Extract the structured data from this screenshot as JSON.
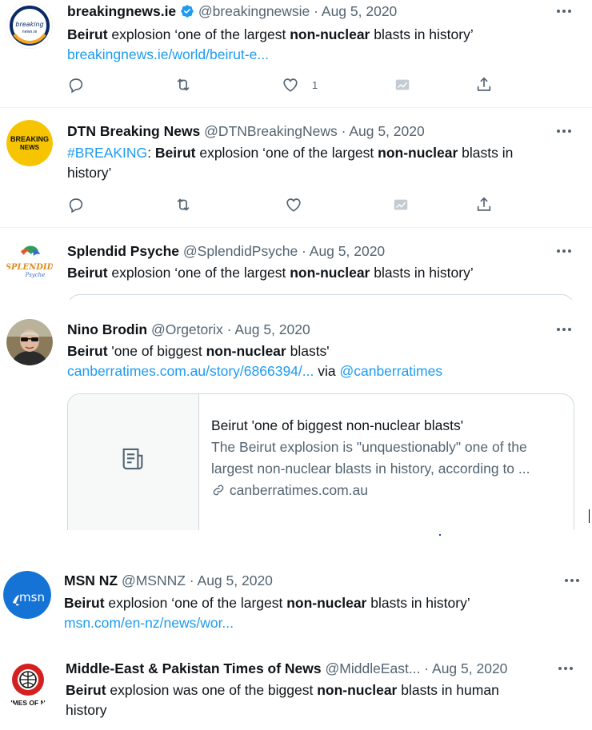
{
  "tweets": [
    {
      "name": "breakingnews.ie",
      "verified": true,
      "handle": "@breakingnewsie",
      "date": "Aug 5, 2020",
      "avatar": {
        "type": "logo",
        "label": "breaking news.ie"
      },
      "text_parts": [
        {
          "t": "Beirut",
          "b": true
        },
        {
          "t": " explosion ‘one of the largest "
        },
        {
          "t": "non-nuclear",
          "b": true
        },
        {
          "t": " blasts in history’"
        }
      ],
      "link": "breakingnews.ie/world/beirut-e...",
      "like_count": "1"
    },
    {
      "name": "DTN Breaking News",
      "handle": "@DTNBreakingNews",
      "date": "Aug 5, 2020",
      "avatar": {
        "type": "logo",
        "label_line1": "BREAKING",
        "label_line2": "NEWS"
      },
      "hashtag": "#BREAKING",
      "text_parts": [
        {
          "t": ": "
        },
        {
          "t": "Beirut",
          "b": true
        },
        {
          "t": " explosion ‘one of the largest "
        },
        {
          "t": "non-nuclear",
          "b": true
        },
        {
          "t": " blasts in history’"
        }
      ]
    },
    {
      "name": "Splendid Psyche",
      "handle": "@SplendidPsyche",
      "date": "Aug 5, 2020",
      "avatar": {
        "type": "logo",
        "label": "SPLENDID",
        "sub": "Psyche"
      },
      "text_parts": [
        {
          "t": "Beirut",
          "b": true
        },
        {
          "t": " explosion ‘one of the largest "
        },
        {
          "t": "non-nuclear",
          "b": true
        },
        {
          "t": " blasts in history’"
        }
      ]
    },
    {
      "name": "Nino Brodin",
      "handle": "@Orgetorix",
      "date": "Aug 5, 2020",
      "avatar": {
        "type": "photo"
      },
      "text_parts": [
        {
          "t": "Beirut",
          "b": true
        },
        {
          "t": " 'one of biggest "
        },
        {
          "t": "non-nuclear",
          "b": true
        },
        {
          "t": " blasts'"
        }
      ],
      "link": "canberratimes.com.au/story/6866394/...",
      "via_label": " via ",
      "via_handle": "@canberratimes",
      "card": {
        "title": "Beirut 'one of biggest non-nuclear blasts'",
        "description": "The Beirut explosion is \"unquestionably\" one of the largest non-nuclear blasts in history, according to ...",
        "domain": "canberratimes.com.au"
      }
    },
    {
      "name": "MSN NZ",
      "handle": "@MSNNZ",
      "date": "Aug 5, 2020",
      "avatar": {
        "type": "logo",
        "label": "msn"
      },
      "text_parts": [
        {
          "t": "Beirut",
          "b": true
        },
        {
          "t": " explosion ‘one of the largest "
        },
        {
          "t": "non-nuclear",
          "b": true
        },
        {
          "t": " blasts in history’"
        }
      ],
      "link": "msn.com/en-nz/news/wor..."
    },
    {
      "name": "Middle-East & Pakistan Times of News",
      "name_truncated": true,
      "handle": "@MiddleEast...",
      "date": "Aug 5, 2020",
      "avatar": {
        "type": "logo",
        "label": "IMES OF N"
      },
      "text_parts": [
        {
          "t": "Beirut",
          "b": true
        },
        {
          "t": " explosion was one of the biggest "
        },
        {
          "t": "non-nuclear",
          "b": true
        },
        {
          "t": " blasts in human history"
        }
      ]
    }
  ],
  "separator": " · ",
  "colors": {
    "text": "#0f1419",
    "secondary": "#536471",
    "link": "#1d9bf0",
    "verified": "#1d9bf0",
    "border": "#cfd9de"
  },
  "icons": [
    "reply-icon",
    "retweet-icon",
    "like-icon",
    "analytics-icon",
    "share-icon",
    "more-icon",
    "verified-badge-icon",
    "article-icon",
    "link-icon"
  ]
}
